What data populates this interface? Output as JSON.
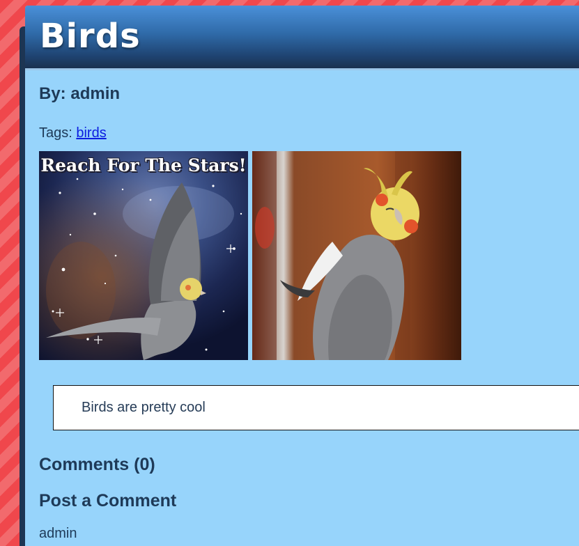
{
  "post": {
    "title": "Birds",
    "byline": "By: admin",
    "tags_label": "Tags: ",
    "tags": [
      "birds"
    ],
    "body": "Birds are pretty cool"
  },
  "images": [
    {
      "caption": "Reach For The Stars!",
      "subject": "cockatiel-in-space"
    },
    {
      "caption": "",
      "subject": "cockatiel-fluffed"
    }
  ],
  "comments": {
    "heading": "Comments (0)",
    "count": 0
  },
  "post_comment": {
    "heading": "Post a Comment",
    "user_label": "admin"
  },
  "colors": {
    "page_background": "#f0474c",
    "card_background": "#97d4fb",
    "header_gradient_top": "#4a90d9",
    "header_gradient_bottom": "#1a3150",
    "text": "#1e3a58",
    "link": "#0b1de0"
  }
}
